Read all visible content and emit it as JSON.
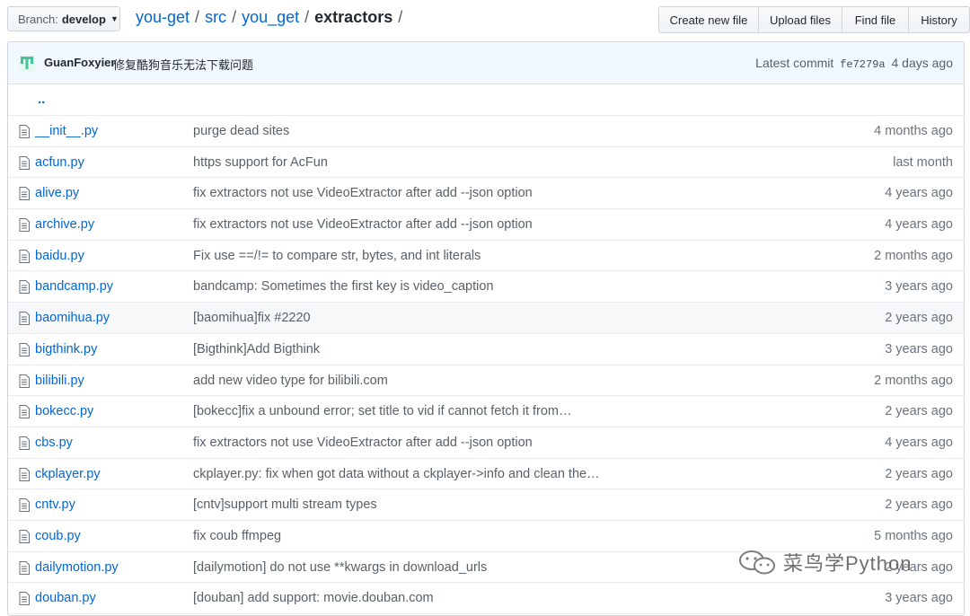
{
  "branch": {
    "prefix": "Branch:",
    "name": "develop"
  },
  "breadcrumb": {
    "repo": "you-get",
    "p1": "src",
    "p2": "you_get",
    "current": "extractors",
    "sep": "/"
  },
  "actions": [
    "Create new file",
    "Upload files",
    "Find file",
    "History"
  ],
  "commit": {
    "author": "GuanFoxyier",
    "message": "修复酷狗音乐无法下载问题",
    "latest_label": "Latest commit",
    "sha": "fe7279a",
    "age": "4 days ago"
  },
  "parent_dir": "..",
  "files": [
    {
      "name": "__init__.py",
      "message": "purge dead sites",
      "age": "4 months ago"
    },
    {
      "name": "acfun.py",
      "message": "https support for AcFun",
      "age": "last month"
    },
    {
      "name": "alive.py",
      "message": "fix extractors not use VideoExtractor after add --json option",
      "age": "4 years ago"
    },
    {
      "name": "archive.py",
      "message": "fix extractors not use VideoExtractor after add --json option",
      "age": "4 years ago"
    },
    {
      "name": "baidu.py",
      "message": "Fix use ==/!= to compare str, bytes, and int literals",
      "age": "2 months ago"
    },
    {
      "name": "bandcamp.py",
      "message": "bandcamp: Sometimes the first key is video_caption",
      "age": "3 years ago"
    },
    {
      "name": "baomihua.py",
      "message": "[baomihua]fix #2220",
      "age": "2 years ago",
      "highlight": true
    },
    {
      "name": "bigthink.py",
      "message": "[Bigthink]Add Bigthink",
      "age": "3 years ago"
    },
    {
      "name": "bilibili.py",
      "message": "add new video type for bilibili.com",
      "age": "2 months ago"
    },
    {
      "name": "bokecc.py",
      "message": "[bokecc]fix a unbound error; set title to vid if cannot fetch it from…",
      "age": "2 years ago"
    },
    {
      "name": "cbs.py",
      "message": "fix extractors not use VideoExtractor after add --json option",
      "age": "4 years ago"
    },
    {
      "name": "ckplayer.py",
      "message": "ckplayer.py: fix when got data without a ckplayer->info and clean the…",
      "age": "2 years ago"
    },
    {
      "name": "cntv.py",
      "message": "[cntv]support multi stream types",
      "age": "2 years ago"
    },
    {
      "name": "coub.py",
      "message": "fix coub ffmpeg",
      "age": "5 months ago"
    },
    {
      "name": "dailymotion.py",
      "message": "[dailymotion] do not use **kwargs in download_urls",
      "age": "2 years ago"
    },
    {
      "name": "douban.py",
      "message": "[douban] add support: movie.douban.com",
      "age": "3 years ago"
    }
  ],
  "watermark": "菜鸟学Python",
  "colors": {
    "link": "#0366d6",
    "commit_bg": "#f1f8ff",
    "muted": "#586069"
  }
}
